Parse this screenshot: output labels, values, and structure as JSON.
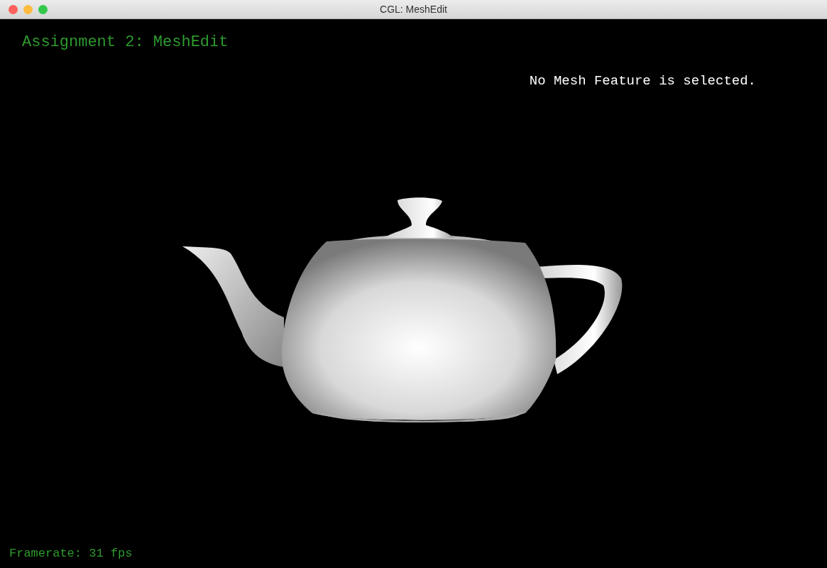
{
  "window": {
    "title": "CGL: MeshEdit"
  },
  "viewport": {
    "heading": "Assignment 2: MeshEdit",
    "selection_status": "No Mesh Feature is selected.",
    "framerate": "Framerate: 31 fps"
  }
}
